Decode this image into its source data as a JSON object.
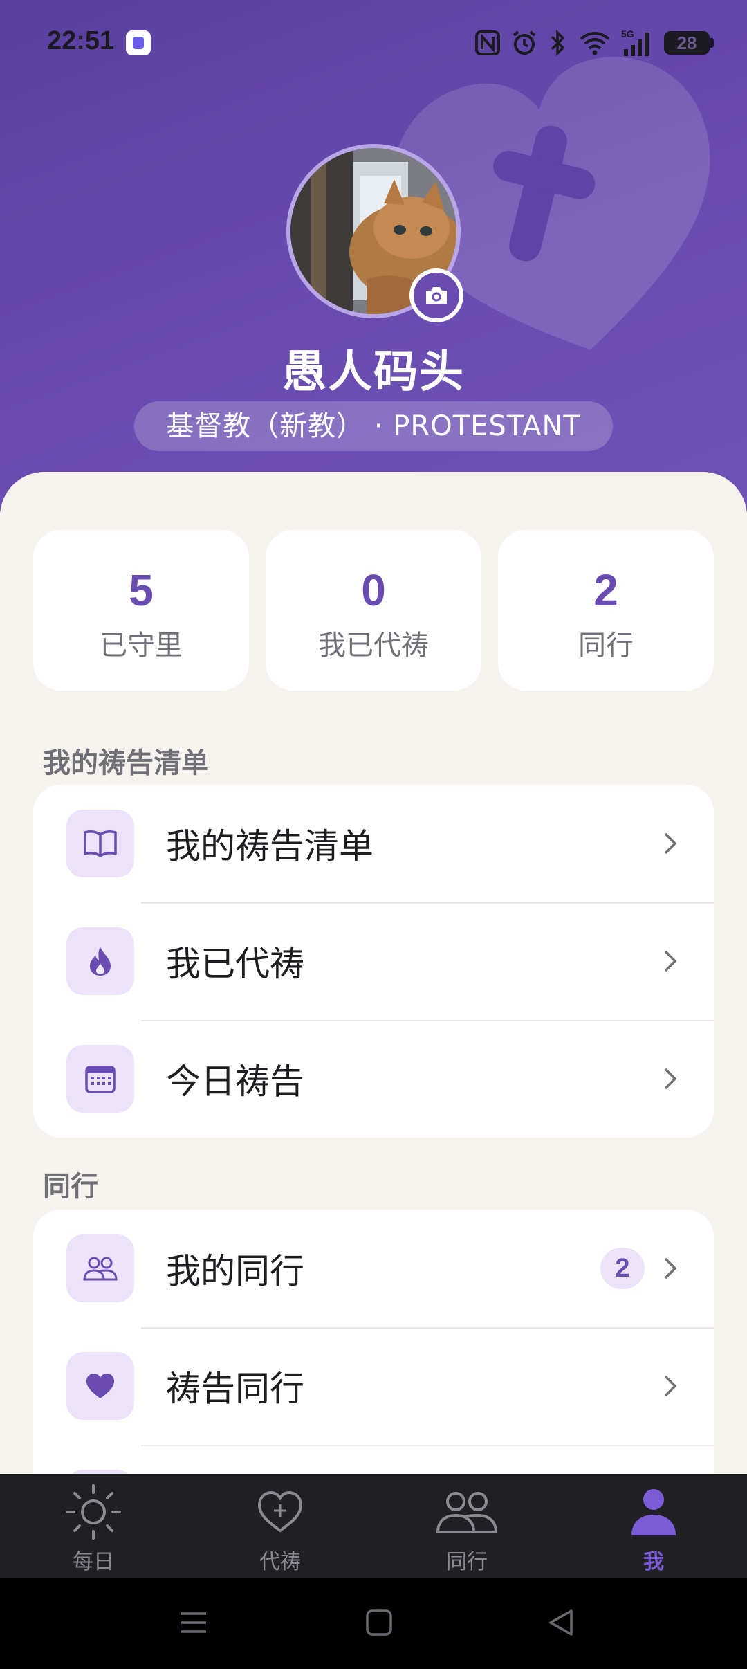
{
  "status_bar": {
    "time": "22:51",
    "battery": "28",
    "network": "5G"
  },
  "profile": {
    "name": "愚人码头",
    "faith": "基督教（新教） · PROTESTANT"
  },
  "stats": [
    {
      "value": "5",
      "label": "已守里"
    },
    {
      "value": "0",
      "label": "我已代祷"
    },
    {
      "value": "2",
      "label": "同行"
    }
  ],
  "prayer_section": {
    "title": "我的祷告清单",
    "items": [
      {
        "label": "我的祷告清单",
        "icon": "book-icon"
      },
      {
        "label": "我已代祷",
        "icon": "flame-icon"
      },
      {
        "label": "今日祷告",
        "icon": "calendar-icon"
      }
    ]
  },
  "companion_section": {
    "title": "同行",
    "items": [
      {
        "label": "我的同行",
        "icon": "people-icon",
        "badge": "2"
      },
      {
        "label": "祷告同行",
        "icon": "heart-icon"
      }
    ]
  },
  "bottom_nav": [
    {
      "label": "每日",
      "icon": "sun-icon",
      "active": false
    },
    {
      "label": "代祷",
      "icon": "heart-plus-icon",
      "active": false
    },
    {
      "label": "同行",
      "icon": "people-icon",
      "active": false
    },
    {
      "label": "我",
      "icon": "person-icon",
      "active": true
    }
  ],
  "colors": {
    "accent": "#6a4cb1",
    "header": "#5a3f9f",
    "icon_bg": "#ece3fb",
    "nav_bg": "#202024"
  }
}
